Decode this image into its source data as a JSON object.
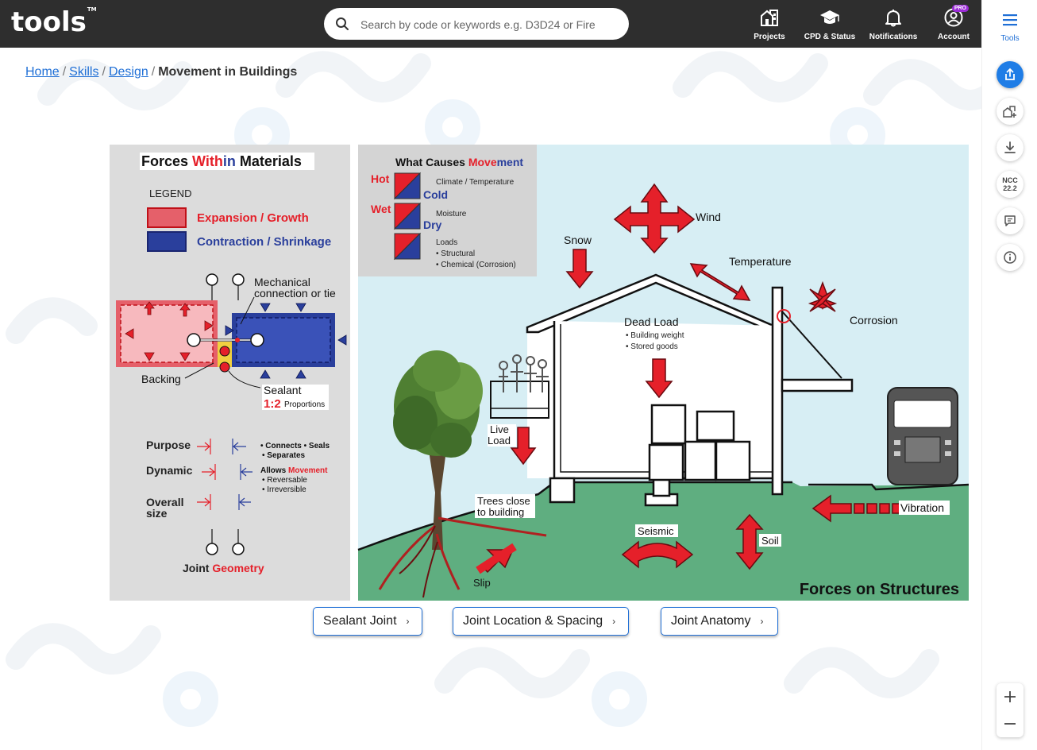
{
  "app": {
    "logo": "tools",
    "logo_tm": "TM"
  },
  "search": {
    "placeholder": "Search by code or keywords e.g. D3D24 or Fire"
  },
  "nav": {
    "projects": "Projects",
    "cpd": "CPD & Status",
    "notifications": "Notifications",
    "account": "Account",
    "pro_badge": "PRO"
  },
  "sidebar": {
    "tools": "Tools",
    "ncc_line1": "NCC",
    "ncc_line2": "22.2"
  },
  "breadcrumb": {
    "home": "Home",
    "skills": "Skills",
    "design": "Design",
    "sep": "/",
    "current": "Movement in Buildings"
  },
  "figure": {
    "left": {
      "title_a": "Forces ",
      "title_b": "With",
      "title_c": "in",
      "title_d": " Materials",
      "legend": "LEGEND",
      "expansion": "Expansion / Growth",
      "contraction": "Contraction / Shrinkage",
      "mech1": "Mechanical",
      "mech2": "connection or tie",
      "backing": "Backing",
      "sealant": "Sealant",
      "ratio": "1:2",
      "proportions": "Proportions",
      "purpose": "Purpose",
      "purpose_desc1": "• Connects • Seals",
      "purpose_desc2": "• Separates",
      "dynamic": "Dynamic",
      "allows": "Allows ",
      "movement": "Movement",
      "reversable": "• Reversable",
      "irreversible": "• Irreversible",
      "overall1": "Overall",
      "overall2": "size",
      "joint": "Joint ",
      "geometry": "Geometry"
    },
    "causes": {
      "title_a": "What Causes ",
      "title_b": "Move",
      "title_c": "ment",
      "hot": "Hot",
      "cold": "Cold",
      "climate": "Climate / Temperature",
      "wet": "Wet",
      "dry": "Dry",
      "moisture": "Moisture",
      "loads": "Loads",
      "structural": "• Structural",
      "chemical": "• Chemical (Corrosion)"
    },
    "right": {
      "wind": "Wind",
      "snow": "Snow",
      "temperature": "Temperature",
      "corrosion": "Corrosion",
      "dead_load": "Dead Load",
      "building_weight": "• Building weight",
      "stored_goods": "• Stored goods",
      "live1": "Live",
      "live2": "Load",
      "trees1": "Trees close",
      "trees2": "to building",
      "seismic": "Seismic",
      "soil": "Soil",
      "vibration": "Vibration",
      "slip": "Slip",
      "forces_on_structures": "Forces on Structures"
    },
    "colors": {
      "red": "#e5202a",
      "blue": "#2a3f9c",
      "sky": "#d7eef4",
      "grass": "#5fae80"
    }
  },
  "links": {
    "sealant_joint": "Sealant Joint",
    "joint_location": "Joint Location & Spacing",
    "joint_anatomy": "Joint Anatomy",
    "chevron": "›"
  }
}
